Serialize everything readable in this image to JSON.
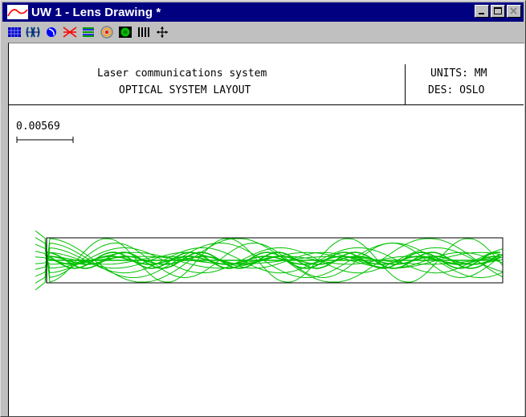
{
  "window": {
    "title": "UW 1 - Lens Drawing *",
    "title_bg": "#000080"
  },
  "window_buttons": [
    {
      "name": "minimize-button",
      "icon": "minimize-icon"
    },
    {
      "name": "maximize-button",
      "icon": "maximize-icon"
    },
    {
      "name": "close-button",
      "icon": "close-icon"
    }
  ],
  "toolbar": {
    "items": [
      {
        "name": "grid-view-button",
        "icon": "grid-icon",
        "color": "#0000c0"
      },
      {
        "name": "lens-layout-button",
        "icon": "lens-elements-icon",
        "color": "#004080"
      },
      {
        "name": "tilt-view-button",
        "icon": "sphere-icon",
        "color": "#0000ff"
      },
      {
        "name": "ray-trace-button",
        "icon": "crossed-rays-icon",
        "color": "#ff0000"
      },
      {
        "name": "ray-fan-button",
        "icon": "ray-fan-icon",
        "color": "#00a000"
      },
      {
        "name": "spot-diagram-button",
        "icon": "concentric-rings-icon",
        "color": "#808080"
      },
      {
        "name": "shaded-view-button",
        "icon": "shaded-sphere-icon",
        "color": "#00c000"
      },
      {
        "name": "wireframe-button",
        "icon": "vertical-lines-icon",
        "color": "#000000"
      },
      {
        "name": "pan-button",
        "icon": "four-arrow-move-icon",
        "color": "#000000"
      }
    ]
  },
  "header": {
    "system_name": "Laser communications system",
    "layout_title": "OPTICAL SYSTEM LAYOUT",
    "units": "UNITS: MM",
    "designer": "DES: OSLO"
  },
  "scale": {
    "label": "0.00569"
  },
  "drawing": {
    "ray_color": "#00c000",
    "outline_color": "#000000"
  }
}
